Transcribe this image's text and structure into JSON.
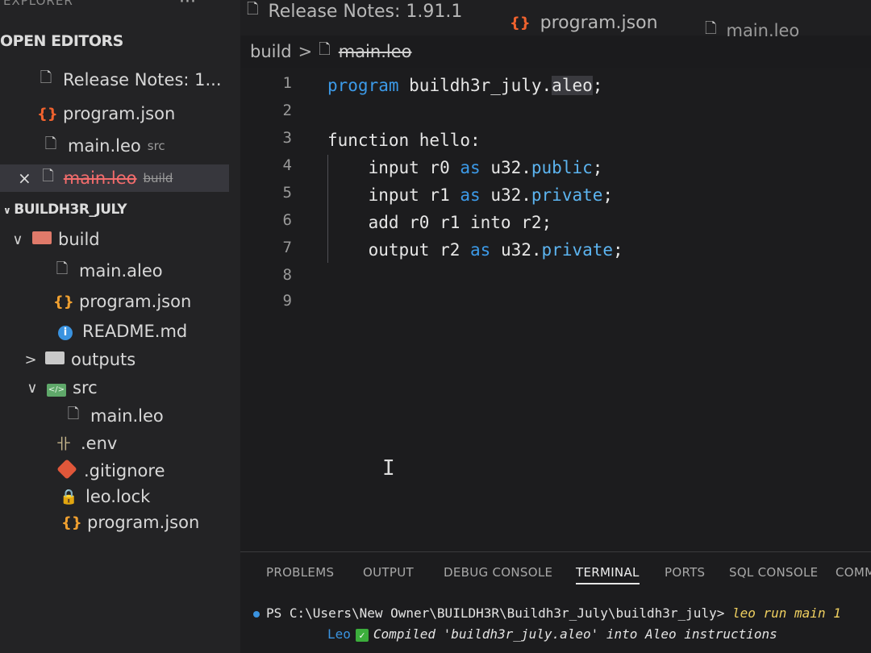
{
  "sidebar": {
    "title": "EXPLORER",
    "more_label": "···",
    "open_editors": {
      "header": "OPEN EDITORS",
      "items": [
        {
          "label": "Release Notes: 1...",
          "icon": "file-icon"
        },
        {
          "label": "program.json",
          "icon": "json-icon"
        },
        {
          "label": "main.leo",
          "desc": "src",
          "icon": "file-icon"
        },
        {
          "label": "main.leo",
          "desc": "build",
          "icon": "file-icon",
          "close": "×",
          "deleted": true
        }
      ]
    },
    "workspace": {
      "header": "BUILDH3R_JULY",
      "tree": [
        {
          "label": "build",
          "twist": "∨",
          "icon": "folder-open-icon"
        },
        {
          "label": "main.aleo",
          "icon": "file-icon"
        },
        {
          "label": "program.json",
          "icon": "json-icon"
        },
        {
          "label": "README.md",
          "icon": "info-icon",
          "icon_text": "i"
        },
        {
          "label": "outputs",
          "twist": ">",
          "icon": "folder-icon"
        },
        {
          "label": "src",
          "twist": "∨",
          "icon": "src-folder-icon",
          "icon_text": "</>"
        },
        {
          "label": "main.leo",
          "icon": "file-icon"
        },
        {
          "label": ".env",
          "icon": "env-icon",
          "icon_text": "卝"
        },
        {
          "label": ".gitignore",
          "icon": "git-icon"
        },
        {
          "label": "leo.lock",
          "icon": "lock-icon"
        },
        {
          "label": "program.json",
          "icon": "json-icon"
        }
      ]
    }
  },
  "tabs": [
    {
      "label": "Release Notes: 1.91.1",
      "icon": "file-icon"
    },
    {
      "label": "program.json",
      "icon": "json-icon"
    },
    {
      "label": "main.leo",
      "icon": "file-icon"
    }
  ],
  "breadcrumb": {
    "segment1": "build",
    "separator": ">",
    "segment2": "main.leo"
  },
  "editor": {
    "line_numbers": [
      "1",
      "2",
      "3",
      "4",
      "5",
      "6",
      "7",
      "8",
      "9"
    ],
    "lines": [
      {
        "t1": "program",
        "t2": " buildh3r_july.",
        "t3": "aleo",
        "t4": ";"
      },
      {},
      {
        "t1": "function hello:"
      },
      {
        "t1": "    input r0 ",
        "t2": "as",
        "t3": " u32.",
        "t4": "public",
        "t5": ";"
      },
      {
        "t1": "    input r1 ",
        "t2": "as",
        "t3": " u32.",
        "t4": "private",
        "t5": ";"
      },
      {
        "t1": "    add r0 r1 into r2;"
      },
      {
        "t1": "    output r2 ",
        "t2": "as",
        "t3": " u32.",
        "t4": "private",
        "t5": ";"
      },
      {},
      {}
    ],
    "cursor_glyph": "I"
  },
  "panel": {
    "tabs": [
      "PROBLEMS",
      "OUTPUT",
      "DEBUG CONSOLE",
      "TERMINAL",
      "PORTS",
      "SQL CONSOLE",
      "COMMENTS"
    ],
    "active_tab": "TERMINAL",
    "terminal": {
      "prompt": "PS C:\\Users\\New Owner\\BUILDH3R\\Buildh3r_July\\buildh3r_july>",
      "command": " leo run main 1",
      "out_tag": "Leo",
      "check_glyph": "✓",
      "out_text": "Compiled 'buildh3r_july.aleo' into Aleo instructions"
    }
  },
  "colors": {
    "keyword": "#3c9ae8",
    "deleted": "#f26c6c",
    "json_icon": "#f0a030",
    "accent": "#3a93e0"
  }
}
